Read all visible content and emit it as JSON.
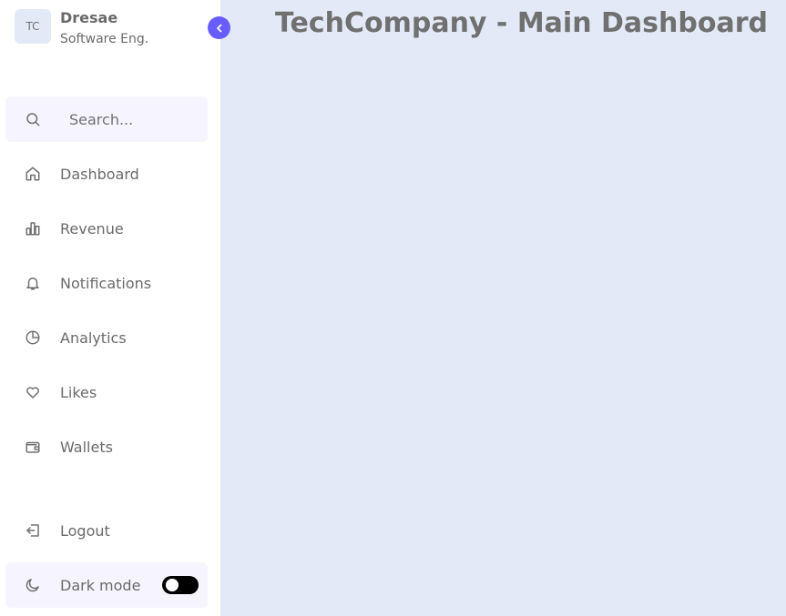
{
  "profile": {
    "initials": "TC",
    "name": "Dresae",
    "role": "Software Eng."
  },
  "search": {
    "placeholder": "Search..."
  },
  "nav": {
    "dashboard": "Dashboard",
    "revenue": "Revenue",
    "notifications": "Notifications",
    "analytics": "Analytics",
    "likes": "Likes",
    "wallets": "Wallets"
  },
  "bottom": {
    "logout": "Logout",
    "dark_mode": "Dark mode",
    "dark_mode_on": false
  },
  "main": {
    "title": "TechCompany - Main Dashboard"
  },
  "colors": {
    "accent": "#695cfe",
    "body_bg": "#e4e9f7",
    "sidebar_bg": "#ffffff",
    "text": "#707070"
  },
  "icons": {
    "toggle": "chevron-left-icon",
    "search": "search-icon",
    "dashboard": "home-icon",
    "revenue": "bar-chart-icon",
    "notifications": "bell-icon",
    "analytics": "pie-chart-icon",
    "likes": "heart-icon",
    "wallets": "wallet-icon",
    "logout": "logout-icon",
    "dark_mode": "moon-icon"
  }
}
